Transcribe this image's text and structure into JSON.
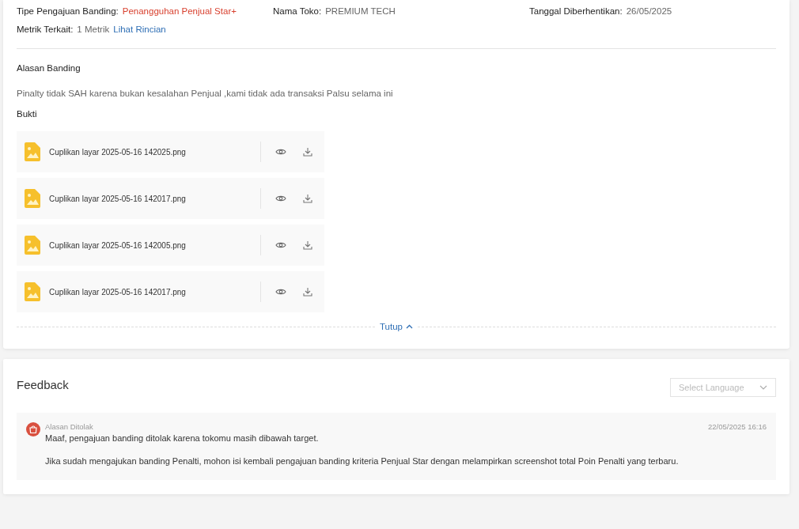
{
  "info": [
    {
      "label": "Tipe Pengajuan Banding:",
      "value": "Penangguhan Penjual Star+",
      "kind": "alert"
    },
    {
      "label": "Nama Toko:",
      "value": "PREMIUM TECH",
      "kind": "plain"
    },
    {
      "label": "Tanggal Diberhentikan:",
      "value": "26/05/2025",
      "kind": "plain"
    }
  ],
  "metric": {
    "label": "Metrik Terkait:",
    "value": "1 Metrik",
    "link": "Lihat Rincian"
  },
  "reason": {
    "title": "Alasan Banding",
    "text": "Pinalty tidak SAH karena bukan kesalahan Penjual ,kami tidak ada transaksi Palsu selama ini"
  },
  "evidence": {
    "title": "Bukti",
    "files": [
      {
        "name": "Cuplikan layar 2025-05-16 142025.png"
      },
      {
        "name": "Cuplikan layar 2025-05-16 142017.png"
      },
      {
        "name": "Cuplikan layar 2025-05-16 142005.png"
      },
      {
        "name": "Cuplikan layar 2025-05-16 142017.png"
      }
    ]
  },
  "collapse": {
    "label": "Tutup",
    "expanded": true
  },
  "feedback": {
    "title": "Feedback",
    "language_select": {
      "placeholder": "Select Language"
    },
    "messages": [
      {
        "label": "Alasan Ditolak",
        "time": "22/05/2025 16:16",
        "lines": [
          "Maaf, pengajuan banding ditolak karena tokomu masih dibawah target.",
          "Jika sudah mengajukan banding Penalti, mohon isi kembali pengajuan banding kriteria Penjual Star dengan melampirkan screenshot total Poin Penalti yang terbaru."
        ]
      }
    ]
  }
}
